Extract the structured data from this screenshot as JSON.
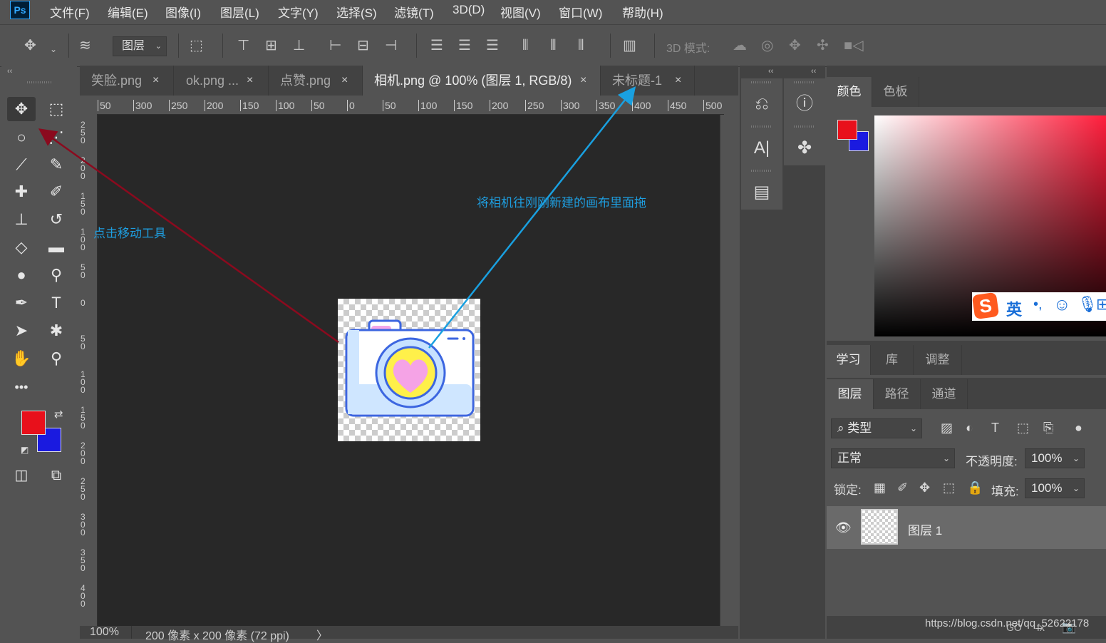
{
  "app": {
    "logo": "Ps"
  },
  "menu": [
    "文件(F)",
    "编辑(E)",
    "图像(I)",
    "图层(L)",
    "文字(Y)",
    "选择(S)",
    "滤镜(T)",
    "3D(D)",
    "视图(V)",
    "窗口(W)",
    "帮助(H)"
  ],
  "options_bar": {
    "auto_select_target": "图层",
    "mode_3d_label": "3D 模式:"
  },
  "tabs": [
    {
      "label": "笑脸.png",
      "close": "×"
    },
    {
      "label": "ok.png ...",
      "close": "×"
    },
    {
      "label": "点赞.png",
      "close": "×"
    },
    {
      "label": "相机.png @ 100% (图层 1, RGB/8)",
      "close": "×",
      "active": true
    },
    {
      "label": "未标题-1",
      "close": "×"
    }
  ],
  "ruler_top": [
    "50",
    "300",
    "250",
    "200",
    "150",
    "100",
    "50",
    "0",
    "50",
    "100",
    "150",
    "200",
    "250",
    "300",
    "350",
    "400",
    "450",
    "500"
  ],
  "ruler_left": [
    "250",
    "200",
    "150",
    "100",
    "50",
    "0",
    "50",
    "100",
    "150",
    "200",
    "250",
    "300",
    "350",
    "400"
  ],
  "status": {
    "zoom": "100%",
    "doc_size": "200 像素 x 200 像素 (72 ppi)",
    "arrow": "〉"
  },
  "annotations": {
    "move_tool_hint": "点击移动工具",
    "drag_hint": "将相机往刚刚新建的画布里面拖"
  },
  "colors": {
    "foreground": "#e8101b",
    "background": "#1a1ae0",
    "annotation_blue": "#1e9ee0",
    "arrow_red": "#8b0a1e",
    "arrow_blue": "#19a0e0"
  },
  "color_panel": {
    "tabs": [
      "颜色",
      "色板"
    ]
  },
  "learn_panel": {
    "tabs": [
      "学习",
      "库",
      "调整"
    ]
  },
  "layers_panel": {
    "tabs": [
      "图层",
      "路径",
      "通道"
    ],
    "filter_kind": "类型",
    "blend_mode": "正常",
    "opacity_label": "不透明度:",
    "opacity_value": "100%",
    "lock_label": "锁定:",
    "fill_label": "填充:",
    "fill_value": "100%",
    "layers": [
      {
        "name": "图层 1",
        "visible": true
      }
    ]
  },
  "ime_bar": {
    "mode": "英",
    "punct": "•,"
  },
  "watermark": "https://blog.csdn.net/qq_52622178"
}
